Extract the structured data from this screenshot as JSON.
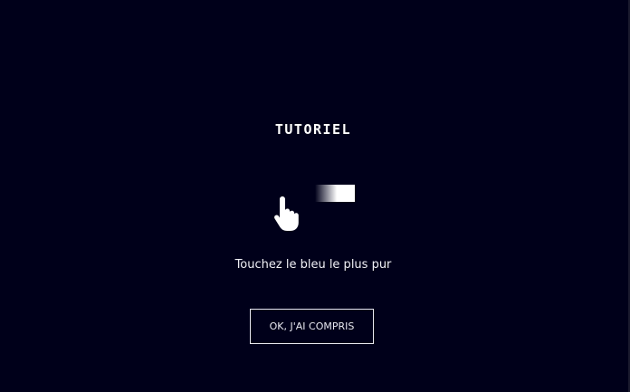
{
  "tutorial": {
    "title": "TUTORIEL",
    "instruction": "Touchez le bleu le plus pur",
    "button_label": "OK, J'AI COMPRIS"
  },
  "icons": {
    "hand": "pointing-hand-icon"
  },
  "colors": {
    "background": "#00001a",
    "text": "#ffffff",
    "swatch_start": "#00001a",
    "swatch_end": "#ffffff"
  }
}
